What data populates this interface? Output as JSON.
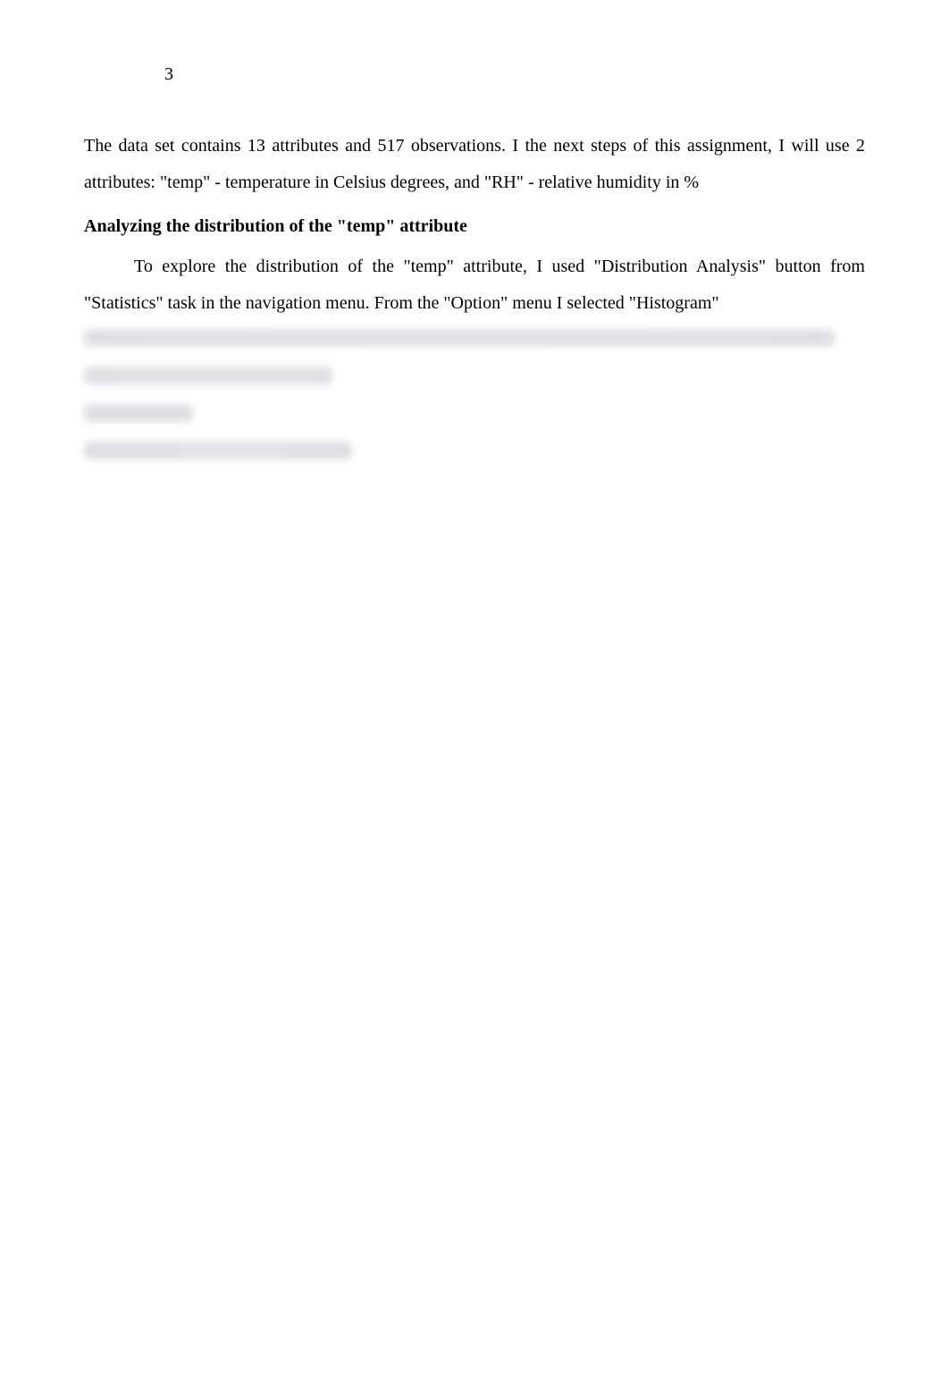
{
  "page": {
    "number": "3"
  },
  "paragraphs": {
    "p1": "The data set contains 13 attributes and 517 observations. I the next steps of this assignment, I will use 2 attributes: \"temp\" - temperature in Celsius degrees, and \"RH\" - relative humidity in %"
  },
  "heading": {
    "analyzing": "Analyzing the distribution of the \"temp\" attribute"
  },
  "paragraphs2": {
    "p2": "To explore the distribution of the \"temp\" attribute, I used \"Distribution Analysis\" button from \"Statistics\" task in the navigation menu. From the \"Option\" menu I selected \"Histogram\""
  }
}
